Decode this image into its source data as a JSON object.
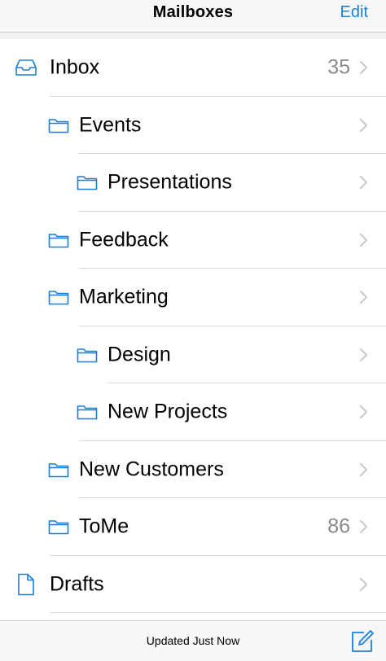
{
  "navbar": {
    "title": "Mailboxes",
    "edit_label": "Edit"
  },
  "accent_color": "#1e7fd6",
  "mailboxes": [
    {
      "label": "Inbox",
      "count": "35",
      "icon": "inbox-tray-icon",
      "level": 0
    },
    {
      "label": "Events",
      "count": "",
      "icon": "folder-icon",
      "level": 1
    },
    {
      "label": "Presentations",
      "count": "",
      "icon": "folder-icon",
      "level": 2
    },
    {
      "label": "Feedback",
      "count": "",
      "icon": "folder-icon",
      "level": 1
    },
    {
      "label": "Marketing",
      "count": "",
      "icon": "folder-icon",
      "level": 1
    },
    {
      "label": "Design",
      "count": "",
      "icon": "folder-icon",
      "level": 2
    },
    {
      "label": "New Projects",
      "count": "",
      "icon": "folder-icon",
      "level": 2
    },
    {
      "label": "New Customers",
      "count": "",
      "icon": "folder-icon",
      "level": 1
    },
    {
      "label": "ToMe",
      "count": "86",
      "icon": "folder-icon",
      "level": 1
    },
    {
      "label": "Drafts",
      "count": "",
      "icon": "document-icon",
      "level": 0
    }
  ],
  "toolbar": {
    "status": "Updated Just Now",
    "compose_icon": "compose-icon"
  }
}
